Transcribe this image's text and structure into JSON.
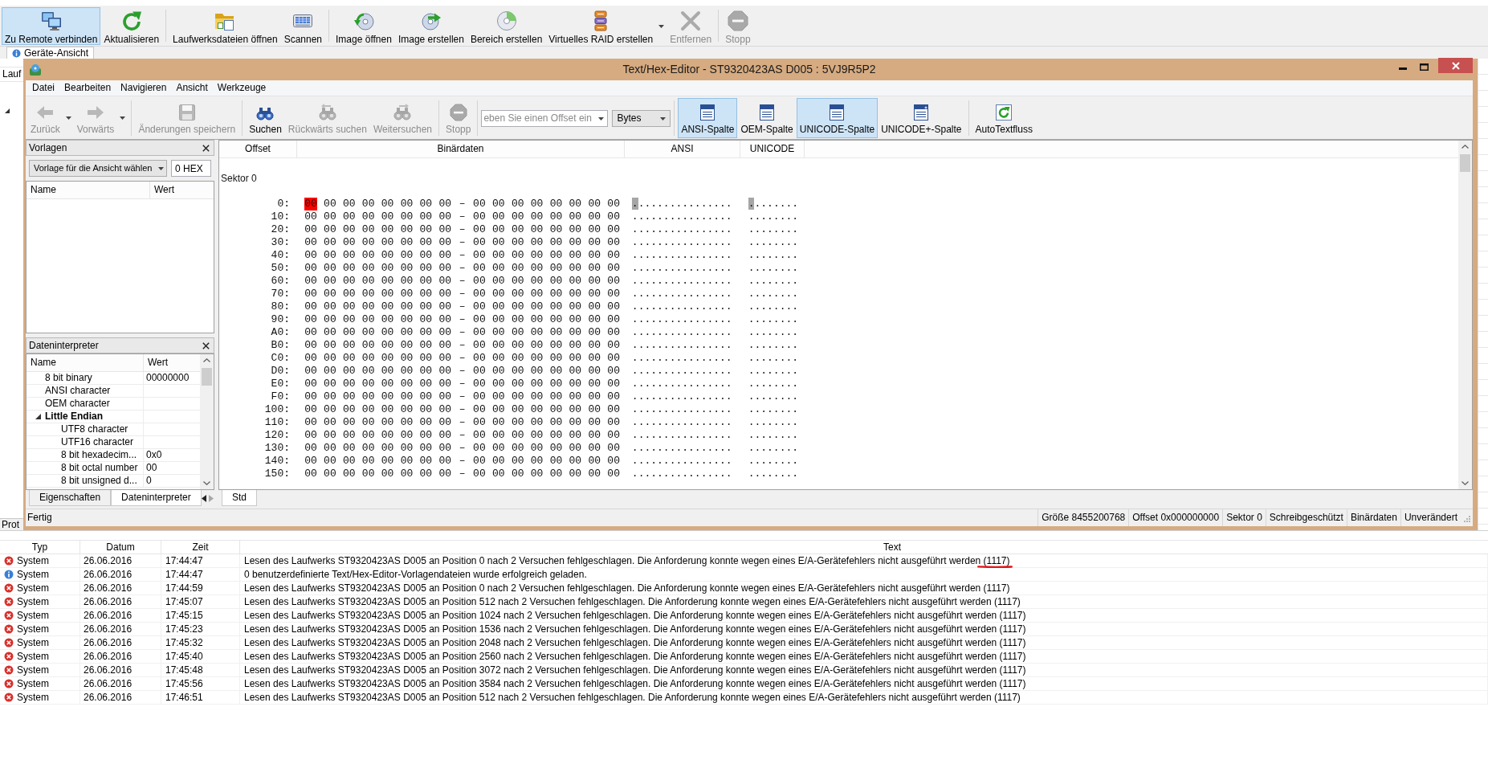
{
  "app_toolbar": {
    "groups": [
      [
        {
          "label": "Zu Remote verbinden",
          "selected": true,
          "disabled": false
        },
        {
          "label": "Aktualisieren",
          "selected": false,
          "disabled": false
        }
      ],
      [
        {
          "label": "Laufwerksdateien öffnen",
          "selected": false,
          "disabled": false
        },
        {
          "label": "Scannen",
          "selected": false,
          "disabled": false
        }
      ],
      [
        {
          "label": "Image öffnen",
          "selected": false,
          "disabled": false
        },
        {
          "label": "Image erstellen",
          "selected": false,
          "disabled": false
        },
        {
          "label": "Bereich erstellen",
          "selected": false,
          "disabled": false
        },
        {
          "label": "Virtuelles RAID erstellen",
          "selected": false,
          "disabled": false,
          "dropdown": true
        },
        {
          "label": "Entfernen",
          "selected": false,
          "disabled": true
        }
      ],
      [
        {
          "label": "Stopp",
          "selected": false,
          "disabled": true
        }
      ]
    ]
  },
  "view_tab": {
    "label": "Geräte-Ansicht"
  },
  "device_table": {
    "columns": [
      "Lauf"
    ]
  },
  "editor_window": {
    "title": "Text/Hex-Editor - ST9320423AS D005 : 5VJ9R5P2",
    "menu": [
      "Datei",
      "Bearbeiten",
      "Navigieren",
      "Ansicht",
      "Werkzeuge"
    ],
    "toolbar": {
      "left_groups": [
        [
          {
            "label": "Zurück",
            "selected": false,
            "disabled": true,
            "dropdown": true
          },
          {
            "label": "Vorwärts",
            "selected": false,
            "disabled": true,
            "dropdown": true
          }
        ],
        [
          {
            "label": "Änderungen speichern",
            "selected": false,
            "disabled": true
          }
        ],
        [
          {
            "label": "Suchen",
            "selected": false,
            "disabled": false
          },
          {
            "label": "Rückwärts suchen",
            "selected": false,
            "disabled": true
          },
          {
            "label": "Weitersuchen",
            "selected": false,
            "disabled": true
          }
        ],
        [
          {
            "label": "Stopp",
            "selected": false,
            "disabled": true
          }
        ]
      ],
      "offset_field": {
        "placeholder": "eben Sie einen Offset ein"
      },
      "unit_select": {
        "value": "Bytes"
      },
      "right_groups": [
        [
          {
            "label": "ANSI-Spalte",
            "selected": true,
            "disabled": false
          },
          {
            "label": "OEM-Spalte",
            "selected": false,
            "disabled": false
          },
          {
            "label": "UNICODE-Spalte",
            "selected": true,
            "disabled": false
          },
          {
            "label": "UNICODE+-Spalte",
            "selected": false,
            "disabled": false
          }
        ],
        [
          {
            "label": "AutoTextfluss",
            "selected": false,
            "disabled": false
          }
        ]
      ]
    },
    "templates_panel": {
      "title": "Vorlagen",
      "template_select": {
        "value": "Vorlage für die Ansicht wählen"
      },
      "offset_field": {
        "value": "0 HEX"
      },
      "columns": [
        "Name",
        "Wert"
      ]
    },
    "interpreter_panel": {
      "title": "Dateninterpreter",
      "columns": [
        "Name",
        "Wert"
      ],
      "items": [
        {
          "kind": "field",
          "name": "8 bit binary",
          "value": "00000000"
        },
        {
          "kind": "field",
          "name": "ANSI character"
        },
        {
          "kind": "field",
          "name": "OEM character"
        },
        {
          "kind": "group",
          "name": "Little Endian",
          "expanded": true,
          "children": [
            {
              "kind": "field",
              "name": "UTF8 character"
            },
            {
              "kind": "field",
              "name": "UTF16 character"
            },
            {
              "kind": "field",
              "name": "8 bit hexadecim...",
              "value": "0x0"
            },
            {
              "kind": "field",
              "name": "8 bit octal number",
              "value": "00"
            },
            {
              "kind": "field",
              "name": "8 bit unsigned d...",
              "value": "0"
            }
          ]
        }
      ]
    },
    "panel_tabs": [
      {
        "label": "Eigenschaften",
        "selected": false
      },
      {
        "label": "Dateninterpreter",
        "selected": true
      }
    ],
    "hex_view": {
      "columns": [
        "Offset",
        "Binärdaten",
        "ANSI",
        "UNICODE"
      ],
      "sector_label": "Sektor 0",
      "rows": [
        {
          "offset": "0:",
          "cursor": true,
          "bytes": [
            "00",
            "00",
            "00",
            "00",
            "00",
            "00",
            "00",
            "00",
            "00",
            "00",
            "00",
            "00",
            "00",
            "00",
            "00",
            "00"
          ],
          "separator": "–",
          "ansi": "................",
          "unicode": "........"
        },
        {
          "offset": "10:",
          "cursor": false,
          "bytes": [
            "00",
            "00",
            "00",
            "00",
            "00",
            "00",
            "00",
            "00",
            "00",
            "00",
            "00",
            "00",
            "00",
            "00",
            "00",
            "00"
          ],
          "separator": "–",
          "ansi": "................",
          "unicode": "........"
        },
        {
          "offset": "20:",
          "cursor": false,
          "bytes": [
            "00",
            "00",
            "00",
            "00",
            "00",
            "00",
            "00",
            "00",
            "00",
            "00",
            "00",
            "00",
            "00",
            "00",
            "00",
            "00"
          ],
          "separator": "–",
          "ansi": "................",
          "unicode": "........"
        },
        {
          "offset": "30:",
          "cursor": false,
          "bytes": [
            "00",
            "00",
            "00",
            "00",
            "00",
            "00",
            "00",
            "00",
            "00",
            "00",
            "00",
            "00",
            "00",
            "00",
            "00",
            "00"
          ],
          "separator": "–",
          "ansi": "................",
          "unicode": "........"
        },
        {
          "offset": "40:",
          "cursor": false,
          "bytes": [
            "00",
            "00",
            "00",
            "00",
            "00",
            "00",
            "00",
            "00",
            "00",
            "00",
            "00",
            "00",
            "00",
            "00",
            "00",
            "00"
          ],
          "separator": "–",
          "ansi": "................",
          "unicode": "........"
        },
        {
          "offset": "50:",
          "cursor": false,
          "bytes": [
            "00",
            "00",
            "00",
            "00",
            "00",
            "00",
            "00",
            "00",
            "00",
            "00",
            "00",
            "00",
            "00",
            "00",
            "00",
            "00"
          ],
          "separator": "–",
          "ansi": "................",
          "unicode": "........"
        },
        {
          "offset": "60:",
          "cursor": false,
          "bytes": [
            "00",
            "00",
            "00",
            "00",
            "00",
            "00",
            "00",
            "00",
            "00",
            "00",
            "00",
            "00",
            "00",
            "00",
            "00",
            "00"
          ],
          "separator": "–",
          "ansi": "................",
          "unicode": "........"
        },
        {
          "offset": "70:",
          "cursor": false,
          "bytes": [
            "00",
            "00",
            "00",
            "00",
            "00",
            "00",
            "00",
            "00",
            "00",
            "00",
            "00",
            "00",
            "00",
            "00",
            "00",
            "00"
          ],
          "separator": "–",
          "ansi": "................",
          "unicode": "........"
        },
        {
          "offset": "80:",
          "cursor": false,
          "bytes": [
            "00",
            "00",
            "00",
            "00",
            "00",
            "00",
            "00",
            "00",
            "00",
            "00",
            "00",
            "00",
            "00",
            "00",
            "00",
            "00"
          ],
          "separator": "–",
          "ansi": "................",
          "unicode": "........"
        },
        {
          "offset": "90:",
          "cursor": false,
          "bytes": [
            "00",
            "00",
            "00",
            "00",
            "00",
            "00",
            "00",
            "00",
            "00",
            "00",
            "00",
            "00",
            "00",
            "00",
            "00",
            "00"
          ],
          "separator": "–",
          "ansi": "................",
          "unicode": "........"
        },
        {
          "offset": "A0:",
          "cursor": false,
          "bytes": [
            "00",
            "00",
            "00",
            "00",
            "00",
            "00",
            "00",
            "00",
            "00",
            "00",
            "00",
            "00",
            "00",
            "00",
            "00",
            "00"
          ],
          "separator": "–",
          "ansi": "................",
          "unicode": "........"
        },
        {
          "offset": "B0:",
          "cursor": false,
          "bytes": [
            "00",
            "00",
            "00",
            "00",
            "00",
            "00",
            "00",
            "00",
            "00",
            "00",
            "00",
            "00",
            "00",
            "00",
            "00",
            "00"
          ],
          "separator": "–",
          "ansi": "................",
          "unicode": "........"
        },
        {
          "offset": "C0:",
          "cursor": false,
          "bytes": [
            "00",
            "00",
            "00",
            "00",
            "00",
            "00",
            "00",
            "00",
            "00",
            "00",
            "00",
            "00",
            "00",
            "00",
            "00",
            "00"
          ],
          "separator": "–",
          "ansi": "................",
          "unicode": "........"
        },
        {
          "offset": "D0:",
          "cursor": false,
          "bytes": [
            "00",
            "00",
            "00",
            "00",
            "00",
            "00",
            "00",
            "00",
            "00",
            "00",
            "00",
            "00",
            "00",
            "00",
            "00",
            "00"
          ],
          "separator": "–",
          "ansi": "................",
          "unicode": "........"
        },
        {
          "offset": "E0:",
          "cursor": false,
          "bytes": [
            "00",
            "00",
            "00",
            "00",
            "00",
            "00",
            "00",
            "00",
            "00",
            "00",
            "00",
            "00",
            "00",
            "00",
            "00",
            "00"
          ],
          "separator": "–",
          "ansi": "................",
          "unicode": "........"
        },
        {
          "offset": "F0:",
          "cursor": false,
          "bytes": [
            "00",
            "00",
            "00",
            "00",
            "00",
            "00",
            "00",
            "00",
            "00",
            "00",
            "00",
            "00",
            "00",
            "00",
            "00",
            "00"
          ],
          "separator": "–",
          "ansi": "................",
          "unicode": "........"
        },
        {
          "offset": "100:",
          "cursor": false,
          "bytes": [
            "00",
            "00",
            "00",
            "00",
            "00",
            "00",
            "00",
            "00",
            "00",
            "00",
            "00",
            "00",
            "00",
            "00",
            "00",
            "00"
          ],
          "separator": "–",
          "ansi": "................",
          "unicode": "........"
        },
        {
          "offset": "110:",
          "cursor": false,
          "bytes": [
            "00",
            "00",
            "00",
            "00",
            "00",
            "00",
            "00",
            "00",
            "00",
            "00",
            "00",
            "00",
            "00",
            "00",
            "00",
            "00"
          ],
          "separator": "–",
          "ansi": "................",
          "unicode": "........"
        },
        {
          "offset": "120:",
          "cursor": false,
          "bytes": [
            "00",
            "00",
            "00",
            "00",
            "00",
            "00",
            "00",
            "00",
            "00",
            "00",
            "00",
            "00",
            "00",
            "00",
            "00",
            "00"
          ],
          "separator": "–",
          "ansi": "................",
          "unicode": "........"
        },
        {
          "offset": "130:",
          "cursor": false,
          "bytes": [
            "00",
            "00",
            "00",
            "00",
            "00",
            "00",
            "00",
            "00",
            "00",
            "00",
            "00",
            "00",
            "00",
            "00",
            "00",
            "00"
          ],
          "separator": "–",
          "ansi": "................",
          "unicode": "........"
        },
        {
          "offset": "140:",
          "cursor": false,
          "bytes": [
            "00",
            "00",
            "00",
            "00",
            "00",
            "00",
            "00",
            "00",
            "00",
            "00",
            "00",
            "00",
            "00",
            "00",
            "00",
            "00"
          ],
          "separator": "–",
          "ansi": "................",
          "unicode": "........"
        },
        {
          "offset": "150:",
          "cursor": false,
          "bytes": [
            "00",
            "00",
            "00",
            "00",
            "00",
            "00",
            "00",
            "00",
            "00",
            "00",
            "00",
            "00",
            "00",
            "00",
            "00",
            "00"
          ],
          "separator": "–",
          "ansi": "................",
          "unicode": "........"
        }
      ]
    },
    "view_tabs": [
      {
        "label": "Std",
        "selected": true
      }
    ],
    "status_bar": {
      "message": "Fertig",
      "panes": [
        "Größe 8455200768",
        "Offset 0x000000000",
        "Sektor 0",
        "Schreibgeschützt",
        "Binärdaten",
        "Unverändert"
      ]
    }
  },
  "log_tab": {
    "label": "Prot"
  },
  "log": {
    "columns": [
      "Typ",
      "Datum",
      "Zeit",
      "Text"
    ],
    "rows": [
      {
        "kind": "error",
        "source": "System",
        "date": "26.06.2016",
        "time": "17:44:47",
        "text": "Lesen des Laufwerks ST9320423AS D005 an Position 0 nach 2 Versuchen fehlgeschlagen. Die Anforderung konnte wegen eines E/A-Gerätefehlers nicht ausgeführt werden (1117)",
        "underlined": true
      },
      {
        "kind": "info",
        "source": "System",
        "date": "26.06.2016",
        "time": "17:44:47",
        "text": "0 benutzerdefinierte Text/Hex-Editor-Vorlagendateien wurde erfolgreich geladen.",
        "underlined": false
      },
      {
        "kind": "error",
        "source": "System",
        "date": "26.06.2016",
        "time": "17:44:59",
        "text": "Lesen des Laufwerks ST9320423AS D005 an Position 0 nach 2 Versuchen fehlgeschlagen. Die Anforderung konnte wegen eines E/A-Gerätefehlers nicht ausgeführt werden (1117)",
        "underlined": false
      },
      {
        "kind": "error",
        "source": "System",
        "date": "26.06.2016",
        "time": "17:45:07",
        "text": "Lesen des Laufwerks ST9320423AS D005 an Position 512 nach 2 Versuchen fehlgeschlagen. Die Anforderung konnte wegen eines E/A-Gerätefehlers nicht ausgeführt werden (1117)",
        "underlined": false
      },
      {
        "kind": "error",
        "source": "System",
        "date": "26.06.2016",
        "time": "17:45:15",
        "text": "Lesen des Laufwerks ST9320423AS D005 an Position 1024 nach 2 Versuchen fehlgeschlagen. Die Anforderung konnte wegen eines E/A-Gerätefehlers nicht ausgeführt werden (1117)",
        "underlined": false
      },
      {
        "kind": "error",
        "source": "System",
        "date": "26.06.2016",
        "time": "17:45:23",
        "text": "Lesen des Laufwerks ST9320423AS D005 an Position 1536 nach 2 Versuchen fehlgeschlagen. Die Anforderung konnte wegen eines E/A-Gerätefehlers nicht ausgeführt werden (1117)",
        "underlined": false
      },
      {
        "kind": "error",
        "source": "System",
        "date": "26.06.2016",
        "time": "17:45:32",
        "text": "Lesen des Laufwerks ST9320423AS D005 an Position 2048 nach 2 Versuchen fehlgeschlagen. Die Anforderung konnte wegen eines E/A-Gerätefehlers nicht ausgeführt werden (1117)",
        "underlined": false
      },
      {
        "kind": "error",
        "source": "System",
        "date": "26.06.2016",
        "time": "17:45:40",
        "text": "Lesen des Laufwerks ST9320423AS D005 an Position 2560 nach 2 Versuchen fehlgeschlagen. Die Anforderung konnte wegen eines E/A-Gerätefehlers nicht ausgeführt werden (1117)",
        "underlined": false
      },
      {
        "kind": "error",
        "source": "System",
        "date": "26.06.2016",
        "time": "17:45:48",
        "text": "Lesen des Laufwerks ST9320423AS D005 an Position 3072 nach 2 Versuchen fehlgeschlagen. Die Anforderung konnte wegen eines E/A-Gerätefehlers nicht ausgeführt werden (1117)",
        "underlined": false
      },
      {
        "kind": "error",
        "source": "System",
        "date": "26.06.2016",
        "time": "17:45:56",
        "text": "Lesen des Laufwerks ST9320423AS D005 an Position 3584 nach 2 Versuchen fehlgeschlagen. Die Anforderung konnte wegen eines E/A-Gerätefehlers nicht ausgeführt werden (1117)",
        "underlined": false
      },
      {
        "kind": "error",
        "source": "System",
        "date": "26.06.2016",
        "time": "17:46:51",
        "text": "Lesen des Laufwerks ST9320423AS D005 an Position 512 nach 2 Versuchen fehlgeschlagen. Die Anforderung konnte wegen eines E/A-Gerätefehlers nicht ausgeführt werden (1117)",
        "underlined": false
      }
    ]
  }
}
